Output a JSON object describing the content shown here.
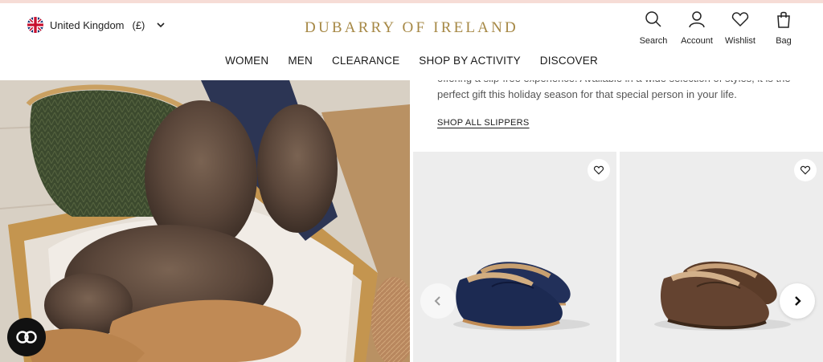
{
  "header": {
    "region": {
      "country": "United Kingdom",
      "currency": "(£)"
    },
    "logo": "DUBARRY OF IRELAND",
    "utilities": [
      {
        "label": "Search",
        "icon": "search-icon"
      },
      {
        "label": "Account",
        "icon": "account-icon"
      },
      {
        "label": "Wishlist",
        "icon": "heart-icon"
      },
      {
        "label": "Bag",
        "icon": "bag-icon"
      }
    ]
  },
  "nav": {
    "items": [
      "WOMEN",
      "MEN",
      "CLEARANCE",
      "SHOP BY ACTIVITY",
      "DISCOVER"
    ]
  },
  "content": {
    "copy_line_1": "offering a slip-free experience. Available in a wide selection of styles, it is the",
    "copy_line_2": "perfect gift this holiday season for that special person in your life.",
    "shop_all": "SHOP ALL SLIPPERS"
  },
  "colors": {
    "brand_gold": "#a68845",
    "card_bg": "#ededed",
    "navy_slipper": "#1f2b52",
    "brown_slipper": "#5a3b28"
  }
}
